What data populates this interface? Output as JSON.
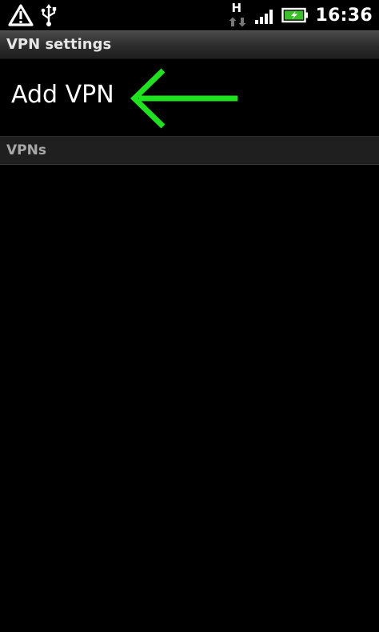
{
  "status_bar": {
    "network_type": "H",
    "time": "16:36",
    "icons": [
      "warning-icon",
      "usb-icon",
      "data-transfer-icon",
      "signal-icon",
      "battery-charging-icon"
    ]
  },
  "title_bar": {
    "title": "VPN settings"
  },
  "add_vpn": {
    "label": "Add VPN",
    "arrow_color": "#1fe21f"
  },
  "vpns_section": {
    "header": "VPNs",
    "items": []
  },
  "colors": {
    "background": "#000000",
    "title_bar": "#2c2c2c",
    "annotation_arrow": "#1fe21f"
  }
}
